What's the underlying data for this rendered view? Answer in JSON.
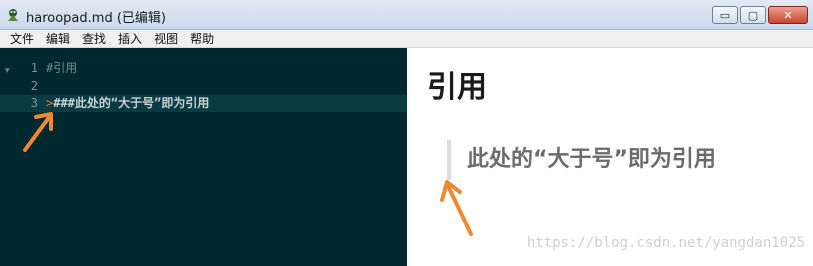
{
  "window": {
    "title": "haroopad.md (已编辑)",
    "minimize_label": "▭",
    "maximize_label": "▢",
    "close_label": "✕"
  },
  "menu": {
    "items": [
      "文件",
      "编辑",
      "查找",
      "插入",
      "视图",
      "帮助"
    ]
  },
  "editor": {
    "fold_marker": "▾",
    "lines": [
      {
        "num": "1",
        "text": "#引用"
      },
      {
        "num": "2",
        "text": ""
      },
      {
        "num": "3",
        "prefix": ">",
        "text": "###此处的“大于号”即为引用"
      }
    ]
  },
  "preview": {
    "heading": "引用",
    "blockquote": "此处的“大于号”即为引用"
  },
  "watermark": "https://blog.csdn.net/yangdan1025",
  "colors": {
    "editor_bg": "#00282f",
    "annotation_arrow": "#f08a32"
  }
}
